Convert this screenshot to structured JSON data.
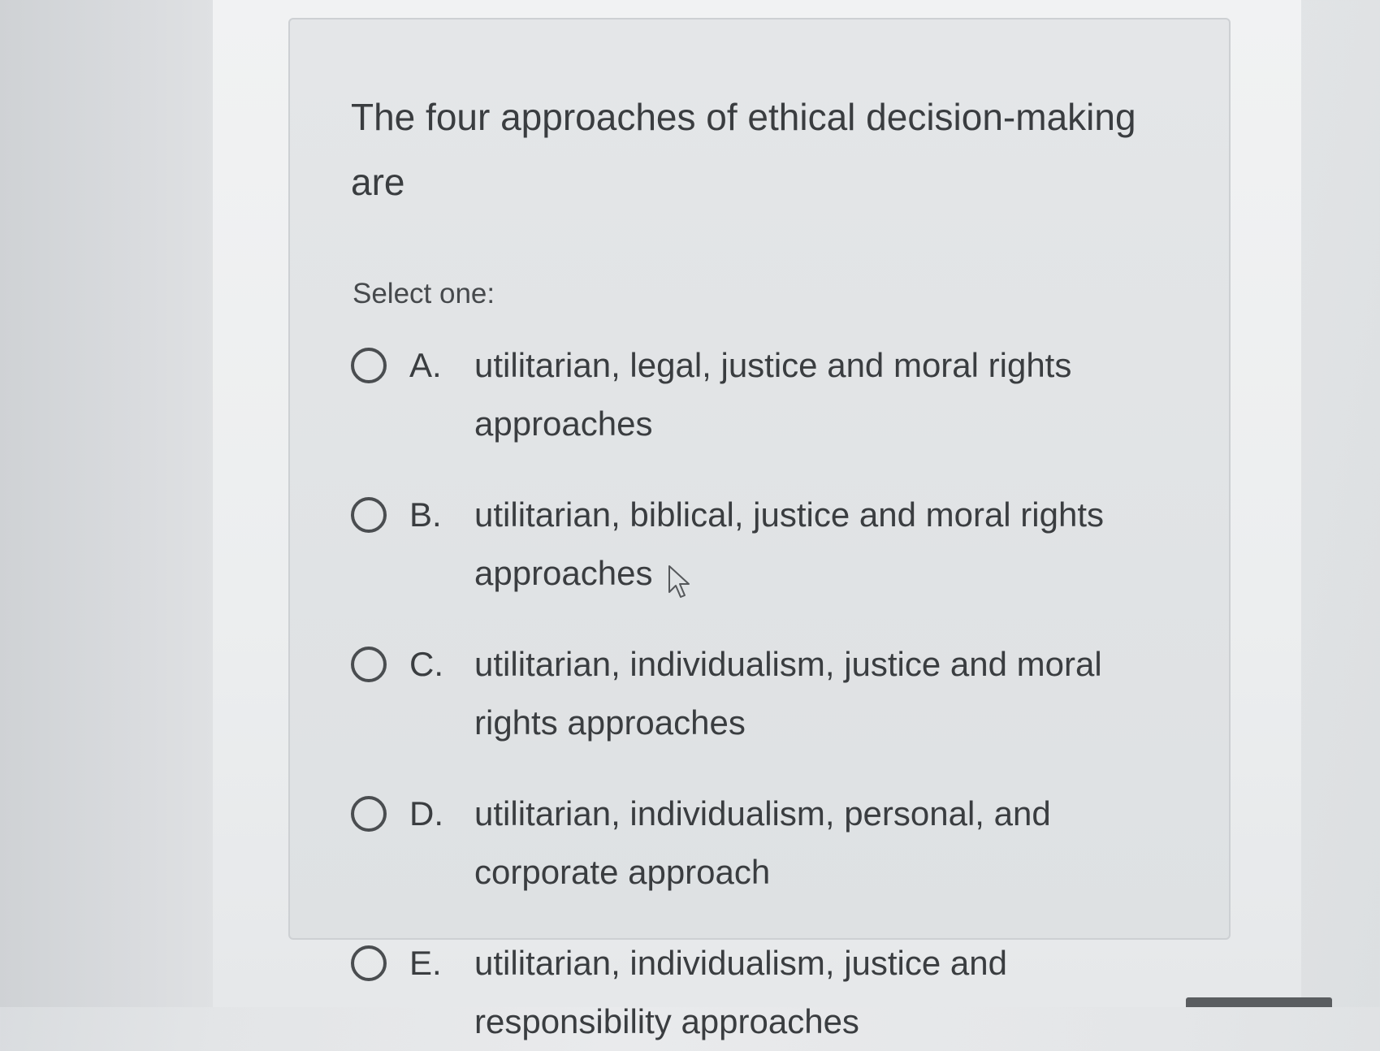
{
  "question": {
    "text": "The four approaches of ethical decision-making are"
  },
  "prompt": "Select one:",
  "options": [
    {
      "letter": "A.",
      "text": "utilitarian, legal, justice and moral rights approaches"
    },
    {
      "letter": "B.",
      "text": "utilitarian, biblical, justice and moral rights approaches"
    },
    {
      "letter": "C.",
      "text": "utilitarian, individualism, justice and moral rights approaches"
    },
    {
      "letter": "D.",
      "text": "utilitarian, individualism, personal, and corporate approach"
    },
    {
      "letter": "E.",
      "text": "utilitarian, individualism, justice and responsibility approaches"
    }
  ],
  "colors": {
    "text": "#3a3d40",
    "card_background": "#e2e4e6",
    "radio_border": "#4a4d50"
  },
  "icons": {
    "radio": "radio-unselected-icon",
    "cursor": "mouse-pointer-icon"
  }
}
